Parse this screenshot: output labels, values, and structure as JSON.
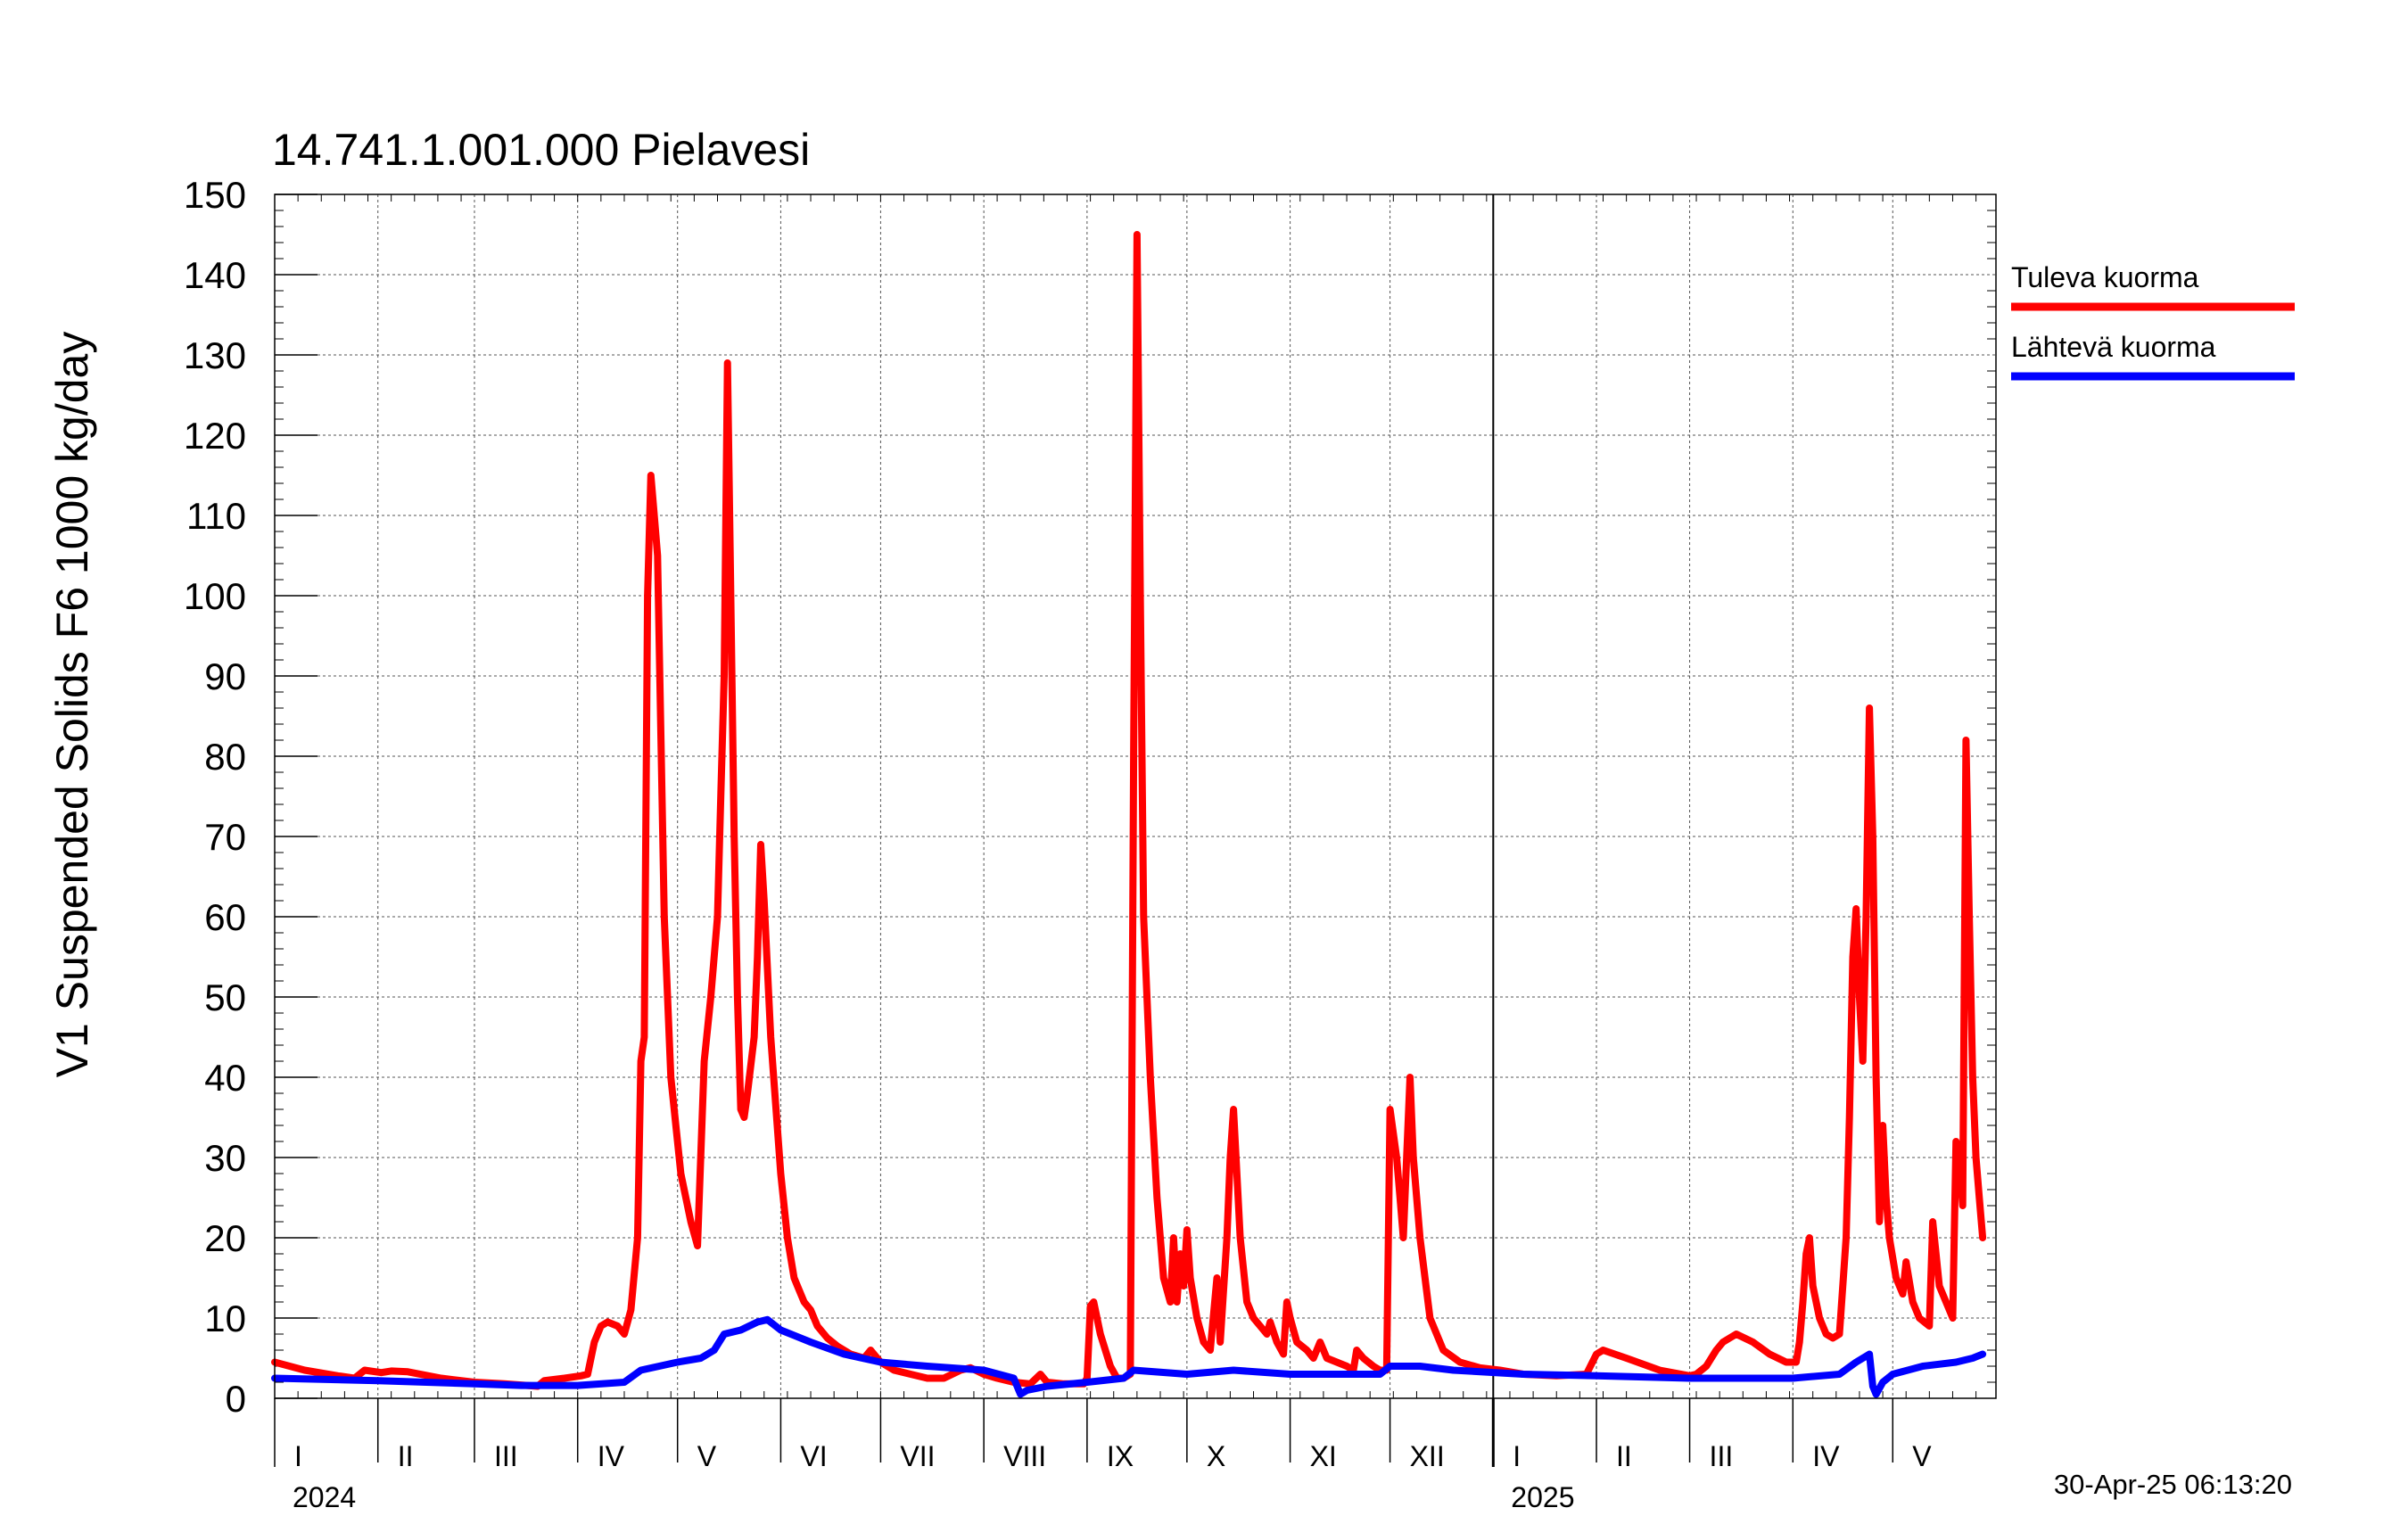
{
  "chart_data": {
    "type": "line",
    "title": "14.741.1.001.000 Pielavesi",
    "ylabel": "V1 Suspended Solids F6 1000 kg/day",
    "xlabel": "",
    "ylim": [
      0,
      150
    ],
    "yticks": [
      0,
      10,
      20,
      30,
      40,
      50,
      60,
      70,
      80,
      90,
      100,
      110,
      120,
      130,
      140,
      150
    ],
    "xlim": [
      "2024-01-01",
      "2025-05-31"
    ],
    "month_labels": [
      "I",
      "II",
      "III",
      "IV",
      "V",
      "VI",
      "VII",
      "VIII",
      "IX",
      "X",
      "XI",
      "XII",
      "I",
      "II",
      "III",
      "IV",
      "V"
    ],
    "year_labels": [
      {
        "label": "2024",
        "date": "2024-01-01"
      },
      {
        "label": "2025",
        "date": "2025-01-01"
      }
    ],
    "grid": true,
    "legend_position": "top-right",
    "timestamp": "30-Apr-25 06:13:20",
    "series": [
      {
        "name": "Tuleva kuorma",
        "color": "#ff0000",
        "points": [
          [
            "2024-01-01",
            4.5
          ],
          [
            "2024-01-10",
            3.5
          ],
          [
            "2024-01-20",
            2.8
          ],
          [
            "2024-01-25",
            2.5
          ],
          [
            "2024-01-28",
            3.5
          ],
          [
            "2024-02-02",
            3.2
          ],
          [
            "2024-02-05",
            3.4
          ],
          [
            "2024-02-10",
            3.3
          ],
          [
            "2024-02-20",
            2.5
          ],
          [
            "2024-03-01",
            2
          ],
          [
            "2024-03-10",
            1.8
          ],
          [
            "2024-03-20",
            1.5
          ],
          [
            "2024-03-22",
            2.2
          ],
          [
            "2024-03-28",
            2.5
          ],
          [
            "2024-04-02",
            2.8
          ],
          [
            "2024-04-04",
            3
          ],
          [
            "2024-04-06",
            7
          ],
          [
            "2024-04-08",
            9
          ],
          [
            "2024-04-10",
            9.5
          ],
          [
            "2024-04-13",
            9
          ],
          [
            "2024-04-15",
            8
          ],
          [
            "2024-04-17",
            11
          ],
          [
            "2024-04-19",
            20
          ],
          [
            "2024-04-20",
            42
          ],
          [
            "2024-04-21",
            45
          ],
          [
            "2024-04-22",
            100
          ],
          [
            "2024-04-23",
            115
          ],
          [
            "2024-04-24",
            110
          ],
          [
            "2024-04-25",
            105
          ],
          [
            "2024-04-27",
            60
          ],
          [
            "2024-04-29",
            40
          ],
          [
            "2024-05-02",
            28
          ],
          [
            "2024-05-05",
            22
          ],
          [
            "2024-05-07",
            19
          ],
          [
            "2024-05-09",
            42
          ],
          [
            "2024-05-11",
            50
          ],
          [
            "2024-05-13",
            60
          ],
          [
            "2024-05-14",
            75
          ],
          [
            "2024-05-15",
            90
          ],
          [
            "2024-05-16",
            129
          ],
          [
            "2024-05-17",
            100
          ],
          [
            "2024-05-18",
            70
          ],
          [
            "2024-05-19",
            50
          ],
          [
            "2024-05-20",
            36
          ],
          [
            "2024-05-21",
            35
          ],
          [
            "2024-05-22",
            38
          ],
          [
            "2024-05-24",
            45
          ],
          [
            "2024-05-25",
            55
          ],
          [
            "2024-05-26",
            69
          ],
          [
            "2024-05-27",
            62
          ],
          [
            "2024-05-29",
            45
          ],
          [
            "2024-06-01",
            28
          ],
          [
            "2024-06-03",
            20
          ],
          [
            "2024-06-05",
            15
          ],
          [
            "2024-06-08",
            12
          ],
          [
            "2024-06-10",
            11
          ],
          [
            "2024-06-12",
            9
          ],
          [
            "2024-06-15",
            7.5
          ],
          [
            "2024-06-18",
            6.5
          ],
          [
            "2024-06-22",
            5.5
          ],
          [
            "2024-06-26",
            5
          ],
          [
            "2024-06-28",
            6
          ],
          [
            "2024-07-01",
            4.5
          ],
          [
            "2024-07-05",
            3.5
          ],
          [
            "2024-07-10",
            3
          ],
          [
            "2024-07-15",
            2.5
          ],
          [
            "2024-07-20",
            2.5
          ],
          [
            "2024-07-25",
            3.5
          ],
          [
            "2024-07-28",
            3.8
          ],
          [
            "2024-08-01",
            3
          ],
          [
            "2024-08-05",
            2.5
          ],
          [
            "2024-08-10",
            2
          ],
          [
            "2024-08-15",
            1.8
          ],
          [
            "2024-08-18",
            3
          ],
          [
            "2024-08-20",
            2
          ],
          [
            "2024-08-25",
            1.8
          ],
          [
            "2024-08-31",
            1.8
          ],
          [
            "2024-09-01",
            2.5
          ],
          [
            "2024-09-02",
            11.5
          ],
          [
            "2024-09-03",
            12
          ],
          [
            "2024-09-05",
            8
          ],
          [
            "2024-09-08",
            4
          ],
          [
            "2024-09-10",
            2.5
          ],
          [
            "2024-09-12",
            2.5
          ],
          [
            "2024-09-14",
            3
          ],
          [
            "2024-09-15",
            80
          ],
          [
            "2024-09-16",
            145
          ],
          [
            "2024-09-17",
            100
          ],
          [
            "2024-09-18",
            60
          ],
          [
            "2024-09-20",
            40
          ],
          [
            "2024-09-22",
            25
          ],
          [
            "2024-09-24",
            15
          ],
          [
            "2024-09-26",
            12
          ],
          [
            "2024-09-27",
            20
          ],
          [
            "2024-09-28",
            12
          ],
          [
            "2024-09-29",
            18
          ],
          [
            "2024-09-30",
            14
          ],
          [
            "2024-10-01",
            21
          ],
          [
            "2024-10-02",
            15
          ],
          [
            "2024-10-04",
            10
          ],
          [
            "2024-10-06",
            7
          ],
          [
            "2024-10-08",
            6
          ],
          [
            "2024-10-10",
            15
          ],
          [
            "2024-10-11",
            7
          ],
          [
            "2024-10-13",
            20
          ],
          [
            "2024-10-14",
            30
          ],
          [
            "2024-10-15",
            36
          ],
          [
            "2024-10-17",
            20
          ],
          [
            "2024-10-19",
            12
          ],
          [
            "2024-10-21",
            10
          ],
          [
            "2024-10-23",
            9
          ],
          [
            "2024-10-25",
            8
          ],
          [
            "2024-10-26",
            9.5
          ],
          [
            "2024-10-28",
            7
          ],
          [
            "2024-10-30",
            5.5
          ],
          [
            "2024-10-31",
            12
          ],
          [
            "2024-11-01",
            10
          ],
          [
            "2024-11-03",
            7
          ],
          [
            "2024-11-06",
            6
          ],
          [
            "2024-11-08",
            5
          ],
          [
            "2024-11-10",
            7
          ],
          [
            "2024-11-12",
            5
          ],
          [
            "2024-11-15",
            4.5
          ],
          [
            "2024-11-18",
            4
          ],
          [
            "2024-11-20",
            3.5
          ],
          [
            "2024-11-21",
            6
          ],
          [
            "2024-11-23",
            5
          ],
          [
            "2024-11-26",
            4
          ],
          [
            "2024-11-28",
            3.5
          ],
          [
            "2024-11-30",
            3.5
          ],
          [
            "2024-12-01",
            36
          ],
          [
            "2024-12-03",
            30
          ],
          [
            "2024-12-04",
            25
          ],
          [
            "2024-12-05",
            20
          ],
          [
            "2024-12-06",
            30
          ],
          [
            "2024-12-07",
            40
          ],
          [
            "2024-12-08",
            30
          ],
          [
            "2024-12-10",
            20
          ],
          [
            "2024-12-13",
            10
          ],
          [
            "2024-12-17",
            6
          ],
          [
            "2024-12-22",
            4.5
          ],
          [
            "2024-12-28",
            3.8
          ],
          [
            "2025-01-03",
            3.5
          ],
          [
            "2025-01-10",
            3
          ],
          [
            "2025-01-20",
            2.8
          ],
          [
            "2025-01-29",
            3
          ],
          [
            "2025-02-01",
            5.5
          ],
          [
            "2025-02-03",
            6
          ],
          [
            "2025-02-10",
            5
          ],
          [
            "2025-02-20",
            3.5
          ],
          [
            "2025-03-01",
            2.8
          ],
          [
            "2025-03-03",
            3
          ],
          [
            "2025-03-06",
            4
          ],
          [
            "2025-03-09",
            6
          ],
          [
            "2025-03-11",
            7
          ],
          [
            "2025-03-15",
            8
          ],
          [
            "2025-03-20",
            7
          ],
          [
            "2025-03-25",
            5.5
          ],
          [
            "2025-03-30",
            4.5
          ],
          [
            "2025-04-02",
            4.5
          ],
          [
            "2025-04-03",
            7
          ],
          [
            "2025-04-04",
            12
          ],
          [
            "2025-04-05",
            18
          ],
          [
            "2025-04-06",
            20
          ],
          [
            "2025-04-07",
            14
          ],
          [
            "2025-04-09",
            10
          ],
          [
            "2025-04-11",
            8
          ],
          [
            "2025-04-13",
            7.5
          ],
          [
            "2025-04-15",
            8
          ],
          [
            "2025-04-17",
            20
          ],
          [
            "2025-04-18",
            35
          ],
          [
            "2025-04-19",
            55
          ],
          [
            "2025-04-20",
            61
          ],
          [
            "2025-04-21",
            50
          ],
          [
            "2025-04-22",
            42
          ],
          [
            "2025-04-23",
            60
          ],
          [
            "2025-04-24",
            86
          ],
          [
            "2025-04-25",
            70
          ],
          [
            "2025-04-26",
            40
          ],
          [
            "2025-04-27",
            22
          ],
          [
            "2025-04-28",
            34
          ],
          [
            "2025-04-29",
            25
          ],
          [
            "2025-04-30",
            20
          ],
          [
            "2025-05-02",
            15
          ],
          [
            "2025-05-04",
            13
          ],
          [
            "2025-05-05",
            17
          ],
          [
            "2025-05-07",
            12
          ],
          [
            "2025-05-09",
            10
          ],
          [
            "2025-05-12",
            9
          ],
          [
            "2025-05-13",
            22
          ],
          [
            "2025-05-15",
            14
          ],
          [
            "2025-05-17",
            12
          ],
          [
            "2025-05-19",
            10
          ],
          [
            "2025-05-20",
            32
          ],
          [
            "2025-05-21",
            30
          ],
          [
            "2025-05-22",
            24
          ],
          [
            "2025-05-23",
            82
          ],
          [
            "2025-05-24",
            60
          ],
          [
            "2025-05-25",
            40
          ],
          [
            "2025-05-26",
            30
          ],
          [
            "2025-05-27",
            25
          ],
          [
            "2025-05-28",
            20
          ]
        ]
      },
      {
        "name": "Lähtevä kuorma",
        "color": "#0000ff",
        "points": [
          [
            "2024-01-01",
            2.5
          ],
          [
            "2024-02-01",
            2.2
          ],
          [
            "2024-03-01",
            1.8
          ],
          [
            "2024-03-15",
            1.6
          ],
          [
            "2024-04-01",
            1.6
          ],
          [
            "2024-04-15",
            2
          ],
          [
            "2024-04-20",
            3.5
          ],
          [
            "2024-05-01",
            4.5
          ],
          [
            "2024-05-08",
            5
          ],
          [
            "2024-05-12",
            6
          ],
          [
            "2024-05-15",
            8
          ],
          [
            "2024-05-20",
            8.5
          ],
          [
            "2024-05-25",
            9.5
          ],
          [
            "2024-05-28",
            9.8
          ],
          [
            "2024-06-01",
            8.5
          ],
          [
            "2024-06-10",
            7
          ],
          [
            "2024-06-20",
            5.5
          ],
          [
            "2024-07-01",
            4.5
          ],
          [
            "2024-07-15",
            4
          ],
          [
            "2024-08-01",
            3.5
          ],
          [
            "2024-08-10",
            2.5
          ],
          [
            "2024-08-12",
            0.5
          ],
          [
            "2024-08-14",
            1
          ],
          [
            "2024-08-20",
            1.5
          ],
          [
            "2024-09-01",
            2
          ],
          [
            "2024-09-12",
            2.5
          ],
          [
            "2024-09-15",
            3.5
          ],
          [
            "2024-10-01",
            3
          ],
          [
            "2024-10-15",
            3.5
          ],
          [
            "2024-11-01",
            3
          ],
          [
            "2024-11-28",
            3
          ],
          [
            "2024-12-01",
            4
          ],
          [
            "2024-12-10",
            4
          ],
          [
            "2024-12-20",
            3.5
          ],
          [
            "2025-01-10",
            3
          ],
          [
            "2025-02-01",
            2.8
          ],
          [
            "2025-03-01",
            2.5
          ],
          [
            "2025-04-01",
            2.5
          ],
          [
            "2025-04-15",
            3
          ],
          [
            "2025-04-20",
            4.5
          ],
          [
            "2025-04-24",
            5.5
          ],
          [
            "2025-04-25",
            1.5
          ],
          [
            "2025-04-26",
            0.5
          ],
          [
            "2025-04-28",
            2
          ],
          [
            "2025-05-01",
            3
          ],
          [
            "2025-05-10",
            4
          ],
          [
            "2025-05-20",
            4.5
          ],
          [
            "2025-05-25",
            5
          ],
          [
            "2025-05-28",
            5.5
          ]
        ]
      }
    ]
  }
}
